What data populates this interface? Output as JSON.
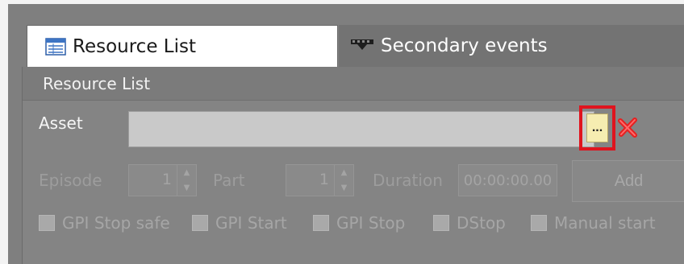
{
  "tabs": [
    {
      "label": "Resource List",
      "icon": "resource-list-icon",
      "active": true
    },
    {
      "label": "Secondary events",
      "icon": "secondary-events-icon",
      "active": false
    }
  ],
  "panel": {
    "title": "Resource List",
    "asset": {
      "label": "Asset",
      "value": "",
      "browse_label": "...",
      "clear_icon": "red-x-icon"
    },
    "episode": {
      "label": "Episode",
      "value": "1"
    },
    "part": {
      "label": "Part",
      "value": "1"
    },
    "duration": {
      "label": "Duration",
      "value": "00:00:00.00"
    },
    "add_label": "Add",
    "checkboxes": [
      {
        "label": "GPI Stop safe",
        "checked": false
      },
      {
        "label": "GPI Start",
        "checked": false
      },
      {
        "label": "GPI Stop",
        "checked": false
      },
      {
        "label": "DStop",
        "checked": false
      },
      {
        "label": "Manual start",
        "checked": false
      }
    ]
  },
  "colors": {
    "background": "#7f7f7f",
    "active_tab": "#ffffff",
    "highlight_border": "#e0141e",
    "browse_button": "#f6edb1"
  }
}
